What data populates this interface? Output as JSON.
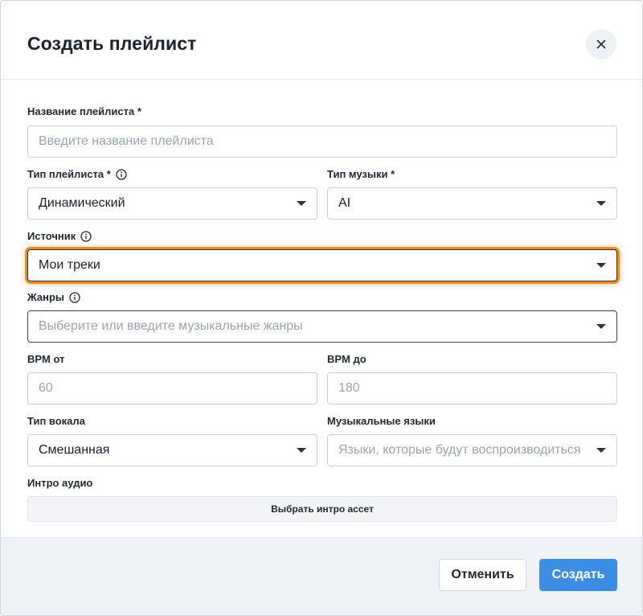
{
  "dialog": {
    "title": "Создать плейлист",
    "close_icon": "close-icon"
  },
  "form": {
    "playlist_name": {
      "label": "Название плейлиста *",
      "placeholder": "Введите название плейлиста",
      "value": ""
    },
    "playlist_type": {
      "label": "Тип плейлиста *",
      "value": "Динамический",
      "info_icon": "info-icon"
    },
    "music_type": {
      "label": "Тип музыки *",
      "value": "AI"
    },
    "source": {
      "label": "Источник",
      "value": "Мои треки",
      "info_icon": "info-icon"
    },
    "genres": {
      "label": "Жанры",
      "placeholder": "Выберите или введите музыкальные жанры",
      "info_icon": "info-icon"
    },
    "bpm_from": {
      "label": "BPM от",
      "placeholder": "60"
    },
    "bpm_to": {
      "label": "BPM до",
      "placeholder": "180"
    },
    "vocal_type": {
      "label": "Тип вокала",
      "value": "Смешанная"
    },
    "music_languages": {
      "label": "Музыкальные языки",
      "placeholder": "Языки, которые будут воспроизводиться"
    },
    "intro_audio": {
      "label": "Интро аудио",
      "button_label": "Выбрать интро ассет"
    }
  },
  "footer": {
    "cancel_label": "Отменить",
    "create_label": "Создать"
  },
  "colors": {
    "accent": "#3b8ee3",
    "focus_ring": "#f08a24",
    "footer_bg": "#eef2f7"
  }
}
